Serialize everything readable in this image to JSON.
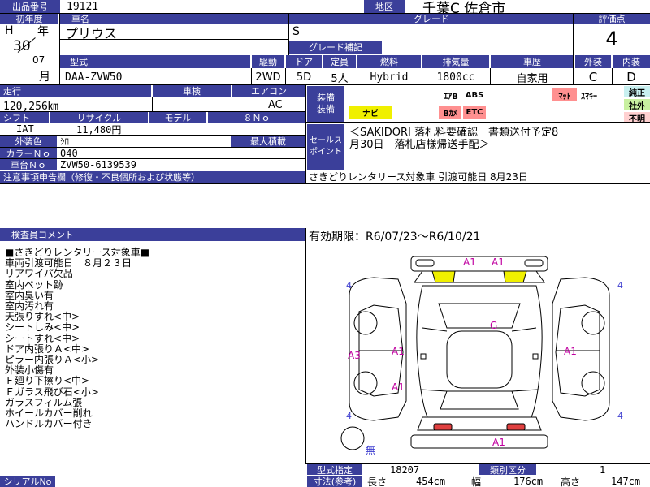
{
  "header": {
    "listing_no_label": "出品番号",
    "listing_no": "19121",
    "region_label": "地区",
    "region": "千葉C 佐倉市",
    "first_reg_label": "初年度",
    "era": "H",
    "year_kanji": "年",
    "year": "30",
    "month": "07",
    "month_kanji": "月",
    "car_name_label": "車名",
    "car_name": "プリウス",
    "grade_label": "グレード",
    "grade": "S",
    "grade_extra_label": "グレード補記",
    "grade_extra": "",
    "score_label": "評価点",
    "score": "4"
  },
  "spec": {
    "headers": [
      "型式",
      "駆動",
      "ドア",
      "定員",
      "燃料",
      "排気量",
      "車歴",
      "外装",
      "内装"
    ],
    "values": [
      "DAA-ZVW50",
      "2WD",
      "5D",
      "5人",
      "Hybrid",
      "1800cc",
      "自家用",
      "C",
      "D"
    ]
  },
  "details": {
    "mileage_label": "走行",
    "mileage": "120,256㎞",
    "inspection_label": "車検",
    "inspection": "",
    "ac_label": "エアコン",
    "ac": "AC",
    "shift_label": "シフト",
    "shift": "IAT",
    "recycle_label": "リサイクル",
    "recycle": "11,480円",
    "model_label": "モデル",
    "model": "",
    "eight_no_label": "８Ｎｏ",
    "eight_no": "",
    "exterior_color_label": "外装色",
    "exterior_color": "ｼﾛ",
    "max_load_label": "最大積載",
    "max_load": "",
    "color_no_label": "カラーＮｏ",
    "color_no": "040",
    "chassis_no_label": "車台Ｎｏ",
    "chassis_no": "ZVW50-6139539",
    "notes_label": "注意事項申告欄（修復・不良個所および状態等）",
    "notes": "さきどりレンタリース対象車 引渡可能日 8月23日"
  },
  "equipment": {
    "label_line1": "装備",
    "label_line2": "装備",
    "items": [
      {
        "name": "ｴｱB",
        "color": "#000000",
        "bg": ""
      },
      {
        "name": "ABS",
        "color": "#000000",
        "bg": ""
      },
      {
        "name": "ﾏｯﾄ",
        "color": "#000000",
        "bg": "#ff9090"
      },
      {
        "name": "ｽﾏｷｰ",
        "color": "#000000",
        "bg": ""
      },
      {
        "name": "純正",
        "color": "#000000",
        "bg": "#c8f0f0"
      },
      {
        "name": "ナビ",
        "color": "#000000",
        "bg": "#f0f000"
      },
      {
        "name": "Bｶﾒ",
        "color": "#000000",
        "bg": "#ff9090"
      },
      {
        "name": "ETC",
        "color": "#000000",
        "bg": "#ff9090"
      },
      {
        "name": "社外",
        "color": "#000000",
        "bg": "#c8f0a0"
      },
      {
        "name": "不明",
        "color": "#000000",
        "bg": "#ffd0d0"
      }
    ]
  },
  "sales_point": {
    "label_line1": "セールス",
    "label_line2": "ポイント",
    "text_line1": "＜SAKIDORI 落札料要確認　書類送付予定8",
    "text_line2": "月30日　落札店様帰送手配＞"
  },
  "inspector": {
    "label": "検査員コメント",
    "comments": [
      "■さきどりレンタリース対象車■",
      "車両引渡可能日　８月２３日",
      "リアワイパ欠品",
      "室内ペット跡",
      "室内臭い有",
      "室内汚れ有",
      "天張りすれ<中>",
      "シートしみ<中>",
      "シートすれ<中>",
      "ドア内張りＡ<中>",
      "ピラー内張りＡ<小>",
      "外装小傷有",
      "Ｆ廻り下擦り<中>",
      "Ｆガラス飛び石<小>",
      "ガラスフィルム張",
      "ホイールカバー削れ",
      "ハンドルカバー付き"
    ]
  },
  "validity": "有効期限：R6/07/23～R6/10/21",
  "diagram_marks": {
    "front_a1_left": "A1",
    "front_a1_right": "A1",
    "roof_g": "G",
    "left_a3": "A3",
    "left_door_a1": "A1",
    "right_door_a1": "A1",
    "left_rear_door_a1": "A1",
    "rear_a1": "A1",
    "tire_fl": "4",
    "tire_fr": "4",
    "tire_rl": "4",
    "tire_rr": "4",
    "spare": "無"
  },
  "footer": {
    "serial_label": "シリアルNo",
    "type_cert_label": "型式指定",
    "type_cert": "18207",
    "class_label": "類別区分",
    "class": "1",
    "dims_label": "寸法(参考)",
    "length_label": "長さ",
    "length": "454cm",
    "width_label": "幅",
    "width": "176cm",
    "height_label": "高さ",
    "height": "147cm"
  }
}
